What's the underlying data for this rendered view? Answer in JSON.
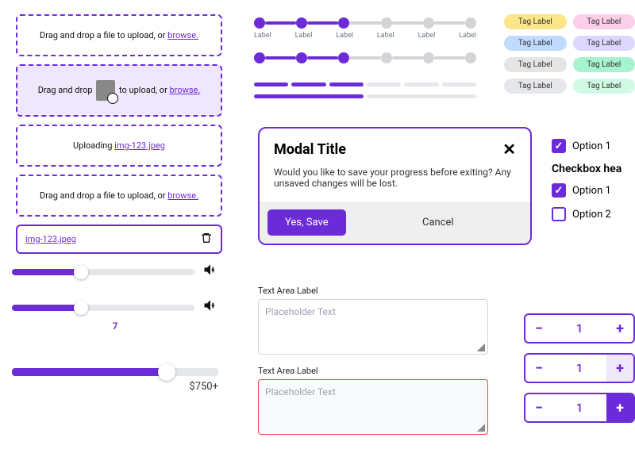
{
  "dropzone": {
    "text_prefix": "Drag and drop a file to upload, or ",
    "text_prefix_short": "Drag and drop ",
    "text_mid": " to upload, or ",
    "browse": "browse.",
    "uploading": "Uploading ",
    "file": "img-123.jpeg"
  },
  "stepper": {
    "labels": [
      "Label",
      "Label",
      "Label",
      "Label",
      "Label",
      "Label"
    ]
  },
  "tags": [
    "Tag Label",
    "Tag Label",
    "Tag Label",
    "Tag Label",
    "Tag Label",
    "Tag Label",
    "Tag Label",
    "Tag Label"
  ],
  "modal": {
    "title": "Modal Title",
    "body": "Would you like to save your progress before exiting? Any unsaved changes will be lost.",
    "primary": "Yes, Save",
    "secondary": "Cancel"
  },
  "checkboxes": {
    "opt1": "Option 1",
    "heading": "Checkbox hea",
    "opt1b": "Option 1",
    "opt2": "Option 2"
  },
  "sliders": {
    "value": "7",
    "price": "$750+"
  },
  "textarea": {
    "label": "Text Area Label",
    "placeholder": "Placeholder Text"
  },
  "numstep": {
    "value": "1"
  }
}
